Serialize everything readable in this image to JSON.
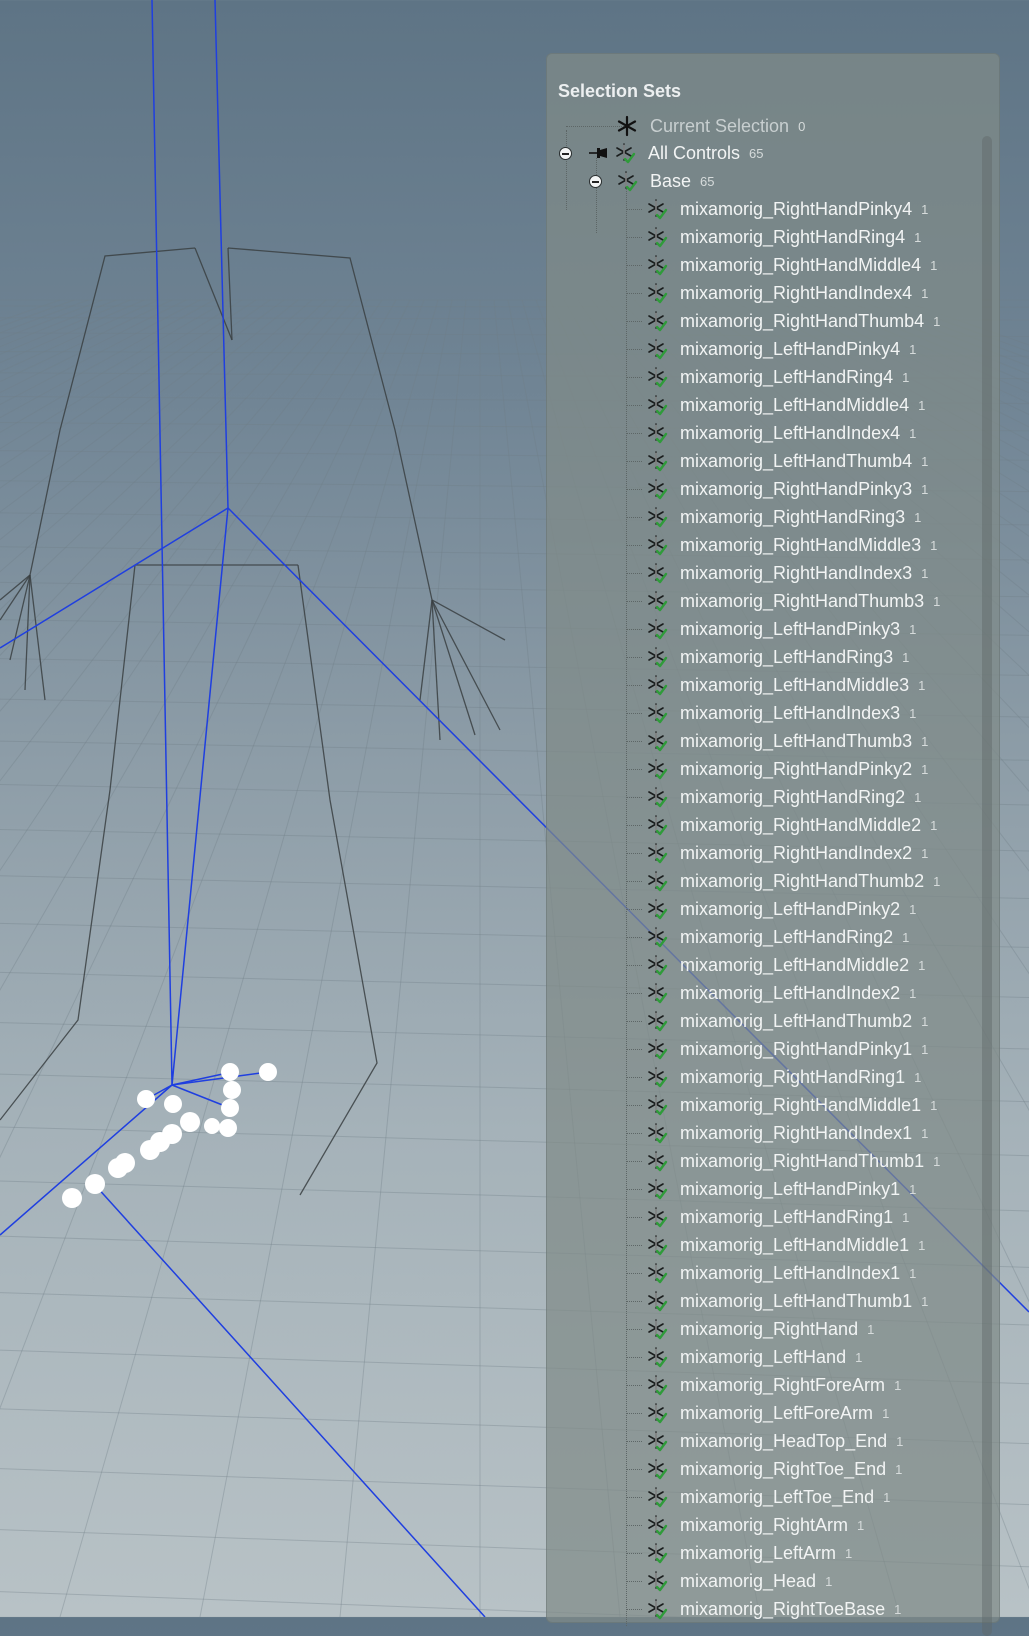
{
  "panel": {
    "title": "Selection Sets",
    "current_selection": {
      "label": "Current Selection",
      "count": "0"
    },
    "all_controls": {
      "label": "All Controls",
      "count": "65"
    },
    "base": {
      "label": "Base",
      "count": "65"
    },
    "items": [
      {
        "label": "mixamorig_RightHandPinky4",
        "count": "1"
      },
      {
        "label": "mixamorig_RightHandRing4",
        "count": "1"
      },
      {
        "label": "mixamorig_RightHandMiddle4",
        "count": "1"
      },
      {
        "label": "mixamorig_RightHandIndex4",
        "count": "1"
      },
      {
        "label": "mixamorig_RightHandThumb4",
        "count": "1"
      },
      {
        "label": "mixamorig_LeftHandPinky4",
        "count": "1"
      },
      {
        "label": "mixamorig_LeftHandRing4",
        "count": "1"
      },
      {
        "label": "mixamorig_LeftHandMiddle4",
        "count": "1"
      },
      {
        "label": "mixamorig_LeftHandIndex4",
        "count": "1"
      },
      {
        "label": "mixamorig_LeftHandThumb4",
        "count": "1"
      },
      {
        "label": "mixamorig_RightHandPinky3",
        "count": "1"
      },
      {
        "label": "mixamorig_RightHandRing3",
        "count": "1"
      },
      {
        "label": "mixamorig_RightHandMiddle3",
        "count": "1"
      },
      {
        "label": "mixamorig_RightHandIndex3",
        "count": "1"
      },
      {
        "label": "mixamorig_RightHandThumb3",
        "count": "1"
      },
      {
        "label": "mixamorig_LeftHandPinky3",
        "count": "1"
      },
      {
        "label": "mixamorig_LeftHandRing3",
        "count": "1"
      },
      {
        "label": "mixamorig_LeftHandMiddle3",
        "count": "1"
      },
      {
        "label": "mixamorig_LeftHandIndex3",
        "count": "1"
      },
      {
        "label": "mixamorig_LeftHandThumb3",
        "count": "1"
      },
      {
        "label": "mixamorig_RightHandPinky2",
        "count": "1"
      },
      {
        "label": "mixamorig_RightHandRing2",
        "count": "1"
      },
      {
        "label": "mixamorig_RightHandMiddle2",
        "count": "1"
      },
      {
        "label": "mixamorig_RightHandIndex2",
        "count": "1"
      },
      {
        "label": "mixamorig_RightHandThumb2",
        "count": "1"
      },
      {
        "label": "mixamorig_LeftHandPinky2",
        "count": "1"
      },
      {
        "label": "mixamorig_LeftHandRing2",
        "count": "1"
      },
      {
        "label": "mixamorig_LeftHandMiddle2",
        "count": "1"
      },
      {
        "label": "mixamorig_LeftHandIndex2",
        "count": "1"
      },
      {
        "label": "mixamorig_LeftHandThumb2",
        "count": "1"
      },
      {
        "label": "mixamorig_RightHandPinky1",
        "count": "1"
      },
      {
        "label": "mixamorig_RightHandRing1",
        "count": "1"
      },
      {
        "label": "mixamorig_RightHandMiddle1",
        "count": "1"
      },
      {
        "label": "mixamorig_RightHandIndex1",
        "count": "1"
      },
      {
        "label": "mixamorig_RightHandThumb1",
        "count": "1"
      },
      {
        "label": "mixamorig_LeftHandPinky1",
        "count": "1"
      },
      {
        "label": "mixamorig_LeftHandRing1",
        "count": "1"
      },
      {
        "label": "mixamorig_LeftHandMiddle1",
        "count": "1"
      },
      {
        "label": "mixamorig_LeftHandIndex1",
        "count": "1"
      },
      {
        "label": "mixamorig_LeftHandThumb1",
        "count": "1"
      },
      {
        "label": "mixamorig_RightHand",
        "count": "1"
      },
      {
        "label": "mixamorig_LeftHand",
        "count": "1"
      },
      {
        "label": "mixamorig_RightForeArm",
        "count": "1"
      },
      {
        "label": "mixamorig_LeftForeArm",
        "count": "1"
      },
      {
        "label": "mixamorig_HeadTop_End",
        "count": "1"
      },
      {
        "label": "mixamorig_RightToe_End",
        "count": "1"
      },
      {
        "label": "mixamorig_LeftToe_End",
        "count": "1"
      },
      {
        "label": "mixamorig_RightArm",
        "count": "1"
      },
      {
        "label": "mixamorig_LeftArm",
        "count": "1"
      },
      {
        "label": "mixamorig_Head",
        "count": "1"
      },
      {
        "label": "mixamorig_RightToeBase",
        "count": "1"
      }
    ]
  },
  "colors": {
    "rig_line": "#1f3fe0",
    "skeleton_line": "#3a3f42",
    "set_icon_check": "#2f9b3a",
    "controller_dot": "#ffffff"
  }
}
